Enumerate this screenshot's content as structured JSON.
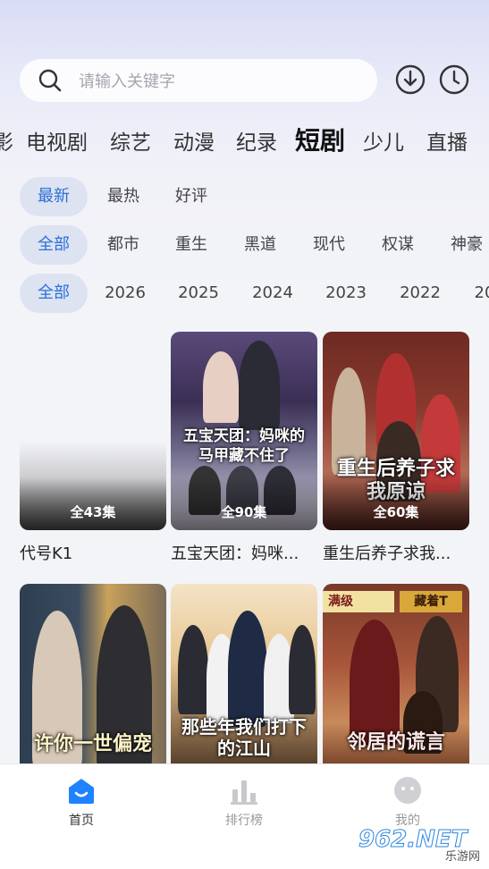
{
  "search": {
    "placeholder": "请输入关键字"
  },
  "header_icons": [
    "download-icon",
    "history-clock-icon"
  ],
  "categories": [
    {
      "label": "影",
      "active": false
    },
    {
      "label": "电视剧",
      "active": false
    },
    {
      "label": "综艺",
      "active": false
    },
    {
      "label": "动漫",
      "active": false
    },
    {
      "label": "纪录",
      "active": false
    },
    {
      "label": "短剧",
      "active": true
    },
    {
      "label": "少儿",
      "active": false
    },
    {
      "label": "直播",
      "active": false
    }
  ],
  "filters": {
    "sort": [
      "最新",
      "最热",
      "好评"
    ],
    "genre": [
      "全部",
      "都市",
      "重生",
      "黑道",
      "现代",
      "权谋",
      "神豪"
    ],
    "year": [
      "全部",
      "2026",
      "2025",
      "2024",
      "2023",
      "2022",
      "20"
    ]
  },
  "shows": [
    {
      "title": "代号K1",
      "episodes": "全43集",
      "poster_text": ""
    },
    {
      "title": "五宝天团：妈咪...",
      "episodes": "全90集",
      "poster_text": "五宝天团：妈咪的马甲藏不住了"
    },
    {
      "title": "重生后养子求我...",
      "episodes": "全60集",
      "poster_text": "重生后养子求我原谅"
    },
    {
      "title": "",
      "episodes": "",
      "poster_text": "许你一世偏宠"
    },
    {
      "title": "",
      "episodes": "",
      "poster_text": "那些年我们打下的江山"
    },
    {
      "title": "",
      "episodes": "",
      "poster_text": "邻居的谎言"
    }
  ],
  "poster_banner_text": "藏着T",
  "poster_banner_prefix": "满级",
  "nav": [
    {
      "label": "首页",
      "icon": "home-icon",
      "active": true
    },
    {
      "label": "排行榜",
      "icon": "ranking-icon",
      "active": false
    },
    {
      "label": "我的",
      "icon": "profile-icon",
      "active": false
    }
  ],
  "watermark": {
    "brand": "962.NET",
    "sub": "乐游网"
  },
  "colors": {
    "accent": "#2a70d8",
    "chip_bg": "#dde3f1",
    "nav_active": "#1f82ff"
  }
}
